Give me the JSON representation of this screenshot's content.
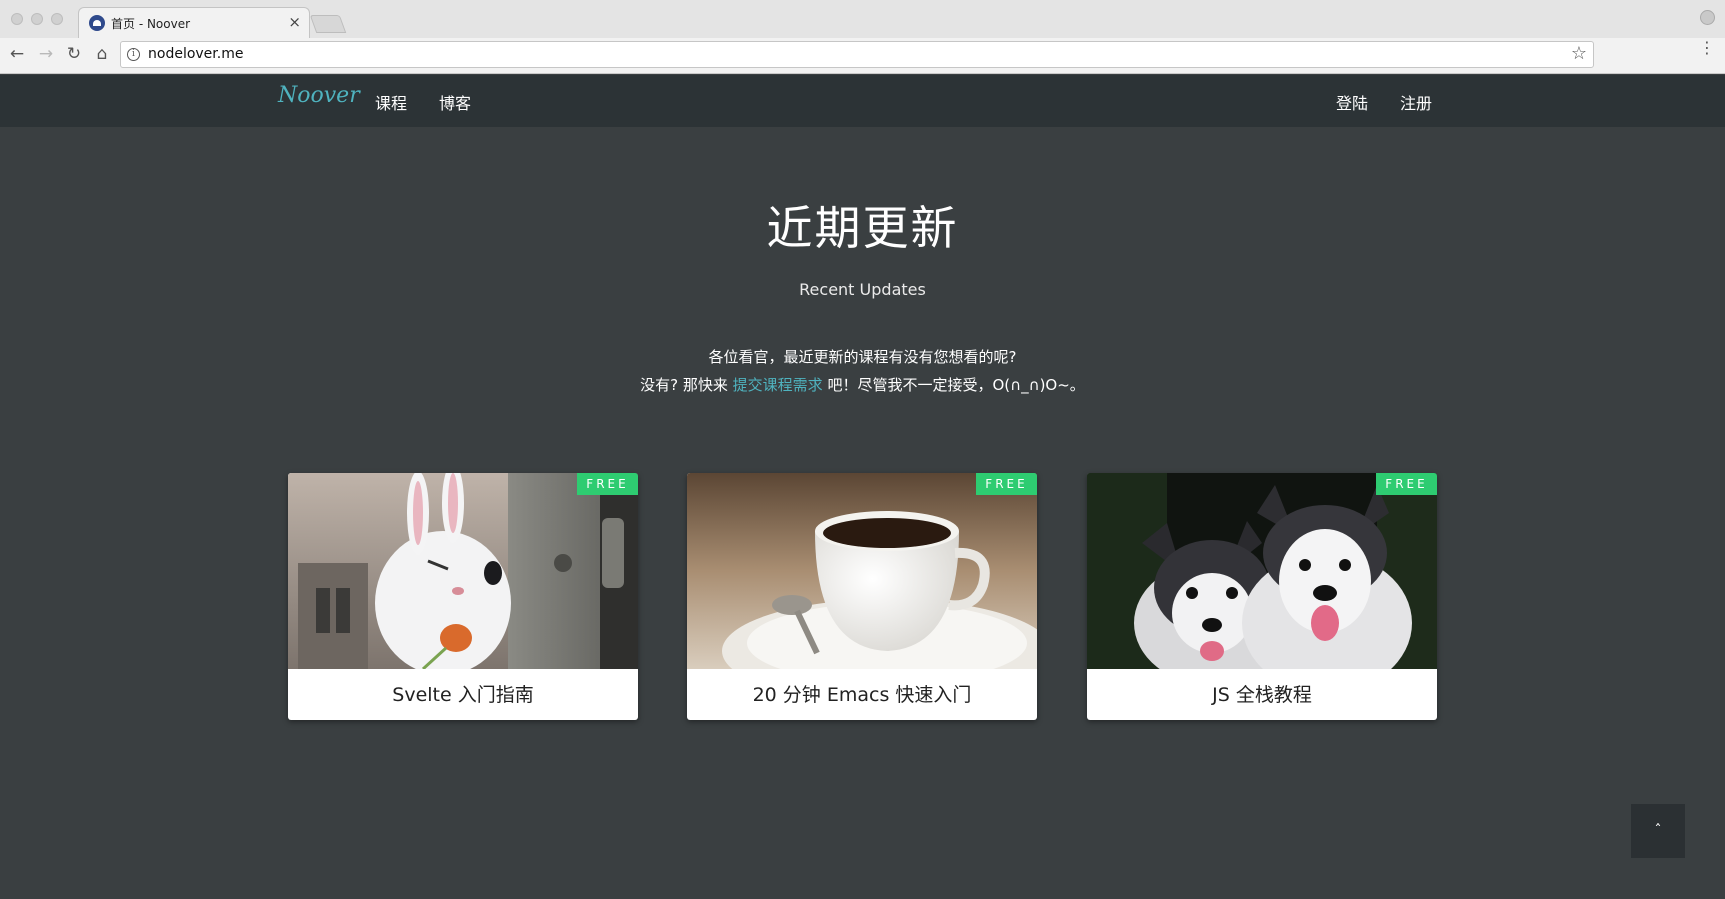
{
  "browser": {
    "tab_title": "首页 - Noover",
    "tab_close": "×",
    "url": "nodelover.me",
    "info_glyph": "i",
    "star_glyph": "☆",
    "back_glyph": "←",
    "forward_glyph": "→",
    "reload_glyph": "↻",
    "home_glyph": "⌂",
    "menu_glyph": "⋮"
  },
  "header": {
    "logo": "Noover",
    "nav": [
      {
        "label": "课程"
      },
      {
        "label": "博客"
      }
    ],
    "login_label": "登陆",
    "register_label": "注册"
  },
  "hero": {
    "title": "近期更新",
    "subtitle": "Recent Updates",
    "line1": "各位看官，最近更新的课程有没有您想看的呢?",
    "line2_before": "没有? 那快来 ",
    "line2_link": "提交课程需求",
    "line2_after": " 吧！尽管我不一定接受，O(∩_∩)O~。"
  },
  "courses": [
    {
      "title": "Svelte 入门指南",
      "badge": "FREE",
      "image": "white-rabbit-image"
    },
    {
      "title": "20 分钟 Emacs 快速入门",
      "badge": "FREE",
      "image": "coffee-cup-image"
    },
    {
      "title": "JS 全栈教程",
      "badge": "FREE",
      "image": "husky-puppies-image"
    }
  ],
  "back_to_top": "ˆ",
  "colors": {
    "page_bg": "#3a3f41",
    "header_bg": "#2c3336",
    "accent": "#4fb3bf",
    "badge": "#2ecc71"
  }
}
